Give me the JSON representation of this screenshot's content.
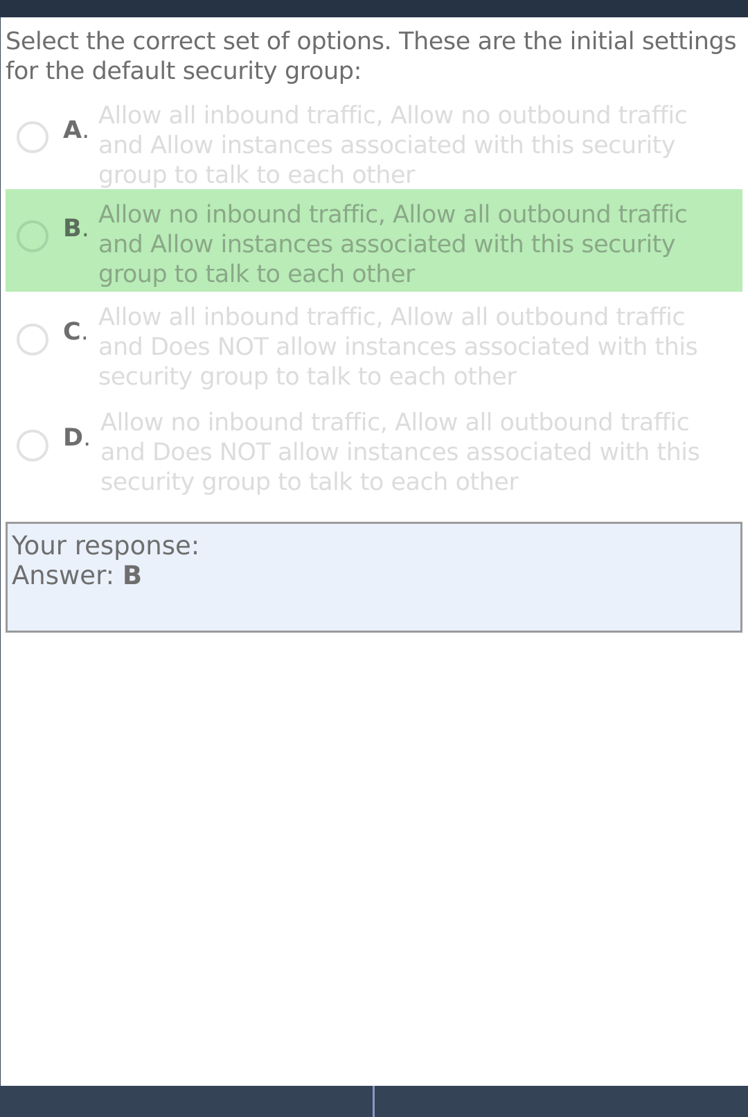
{
  "question": {
    "text": "Select the correct set of options. These are the initial settings for the default security group:"
  },
  "options": [
    {
      "letter": "A",
      "text": "Allow all inbound traffic, Allow no outbound traffic and Allow instances associated with this security group to talk to each other",
      "selected": false
    },
    {
      "letter": "B",
      "text": "Allow no inbound traffic, Allow all outbound traffic and Allow instances associated with this security group to talk to each other",
      "selected": true
    },
    {
      "letter": "C",
      "text": "Allow all inbound traffic, Allow all outbound traffic and Does NOT allow instances associated with this security group to talk to each other",
      "selected": false
    },
    {
      "letter": "D",
      "text": "Allow no inbound traffic, Allow all outbound traffic and Does NOT allow instances associated with this security group to talk to each other",
      "selected": false
    }
  ],
  "response": {
    "label": "Your response:",
    "answer_label": "Answer:",
    "answer_value": "B"
  },
  "colors": {
    "selected_bg": "#b9ecb7",
    "response_bg": "#eaf1fb",
    "header_bar": "#263345",
    "footer_bar": "#344355"
  }
}
